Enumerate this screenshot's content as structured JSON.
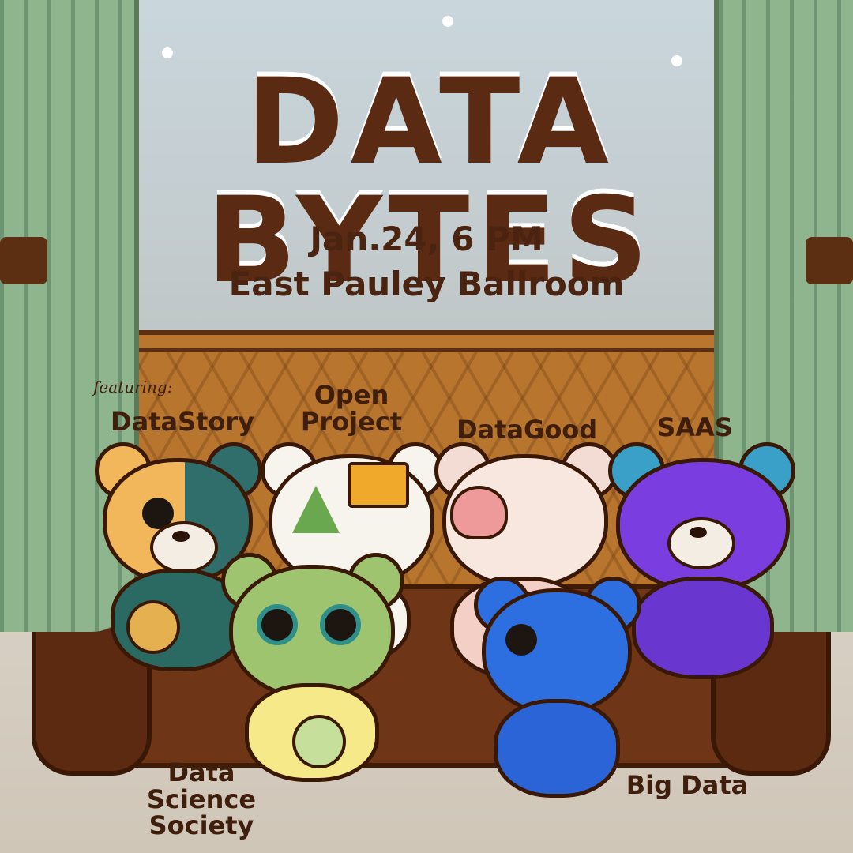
{
  "poster": {
    "title": "DATA BYTES",
    "date_time": "Jan.24, 6 PM",
    "venue": "East Pauley Ballroom",
    "featuring_label": "featuring:",
    "clubs": {
      "datastory": "DataStory",
      "open_project": "Open Project",
      "datagood": "DataGood",
      "saas": "SAAS",
      "data_science_society": "Data Science Society",
      "big_data": "Big Data"
    }
  },
  "colors": {
    "title_text": "#5a2a13",
    "sofa": "#6e3516",
    "curtain": "#8fb58e",
    "window_sky": "#c9d6dc"
  }
}
